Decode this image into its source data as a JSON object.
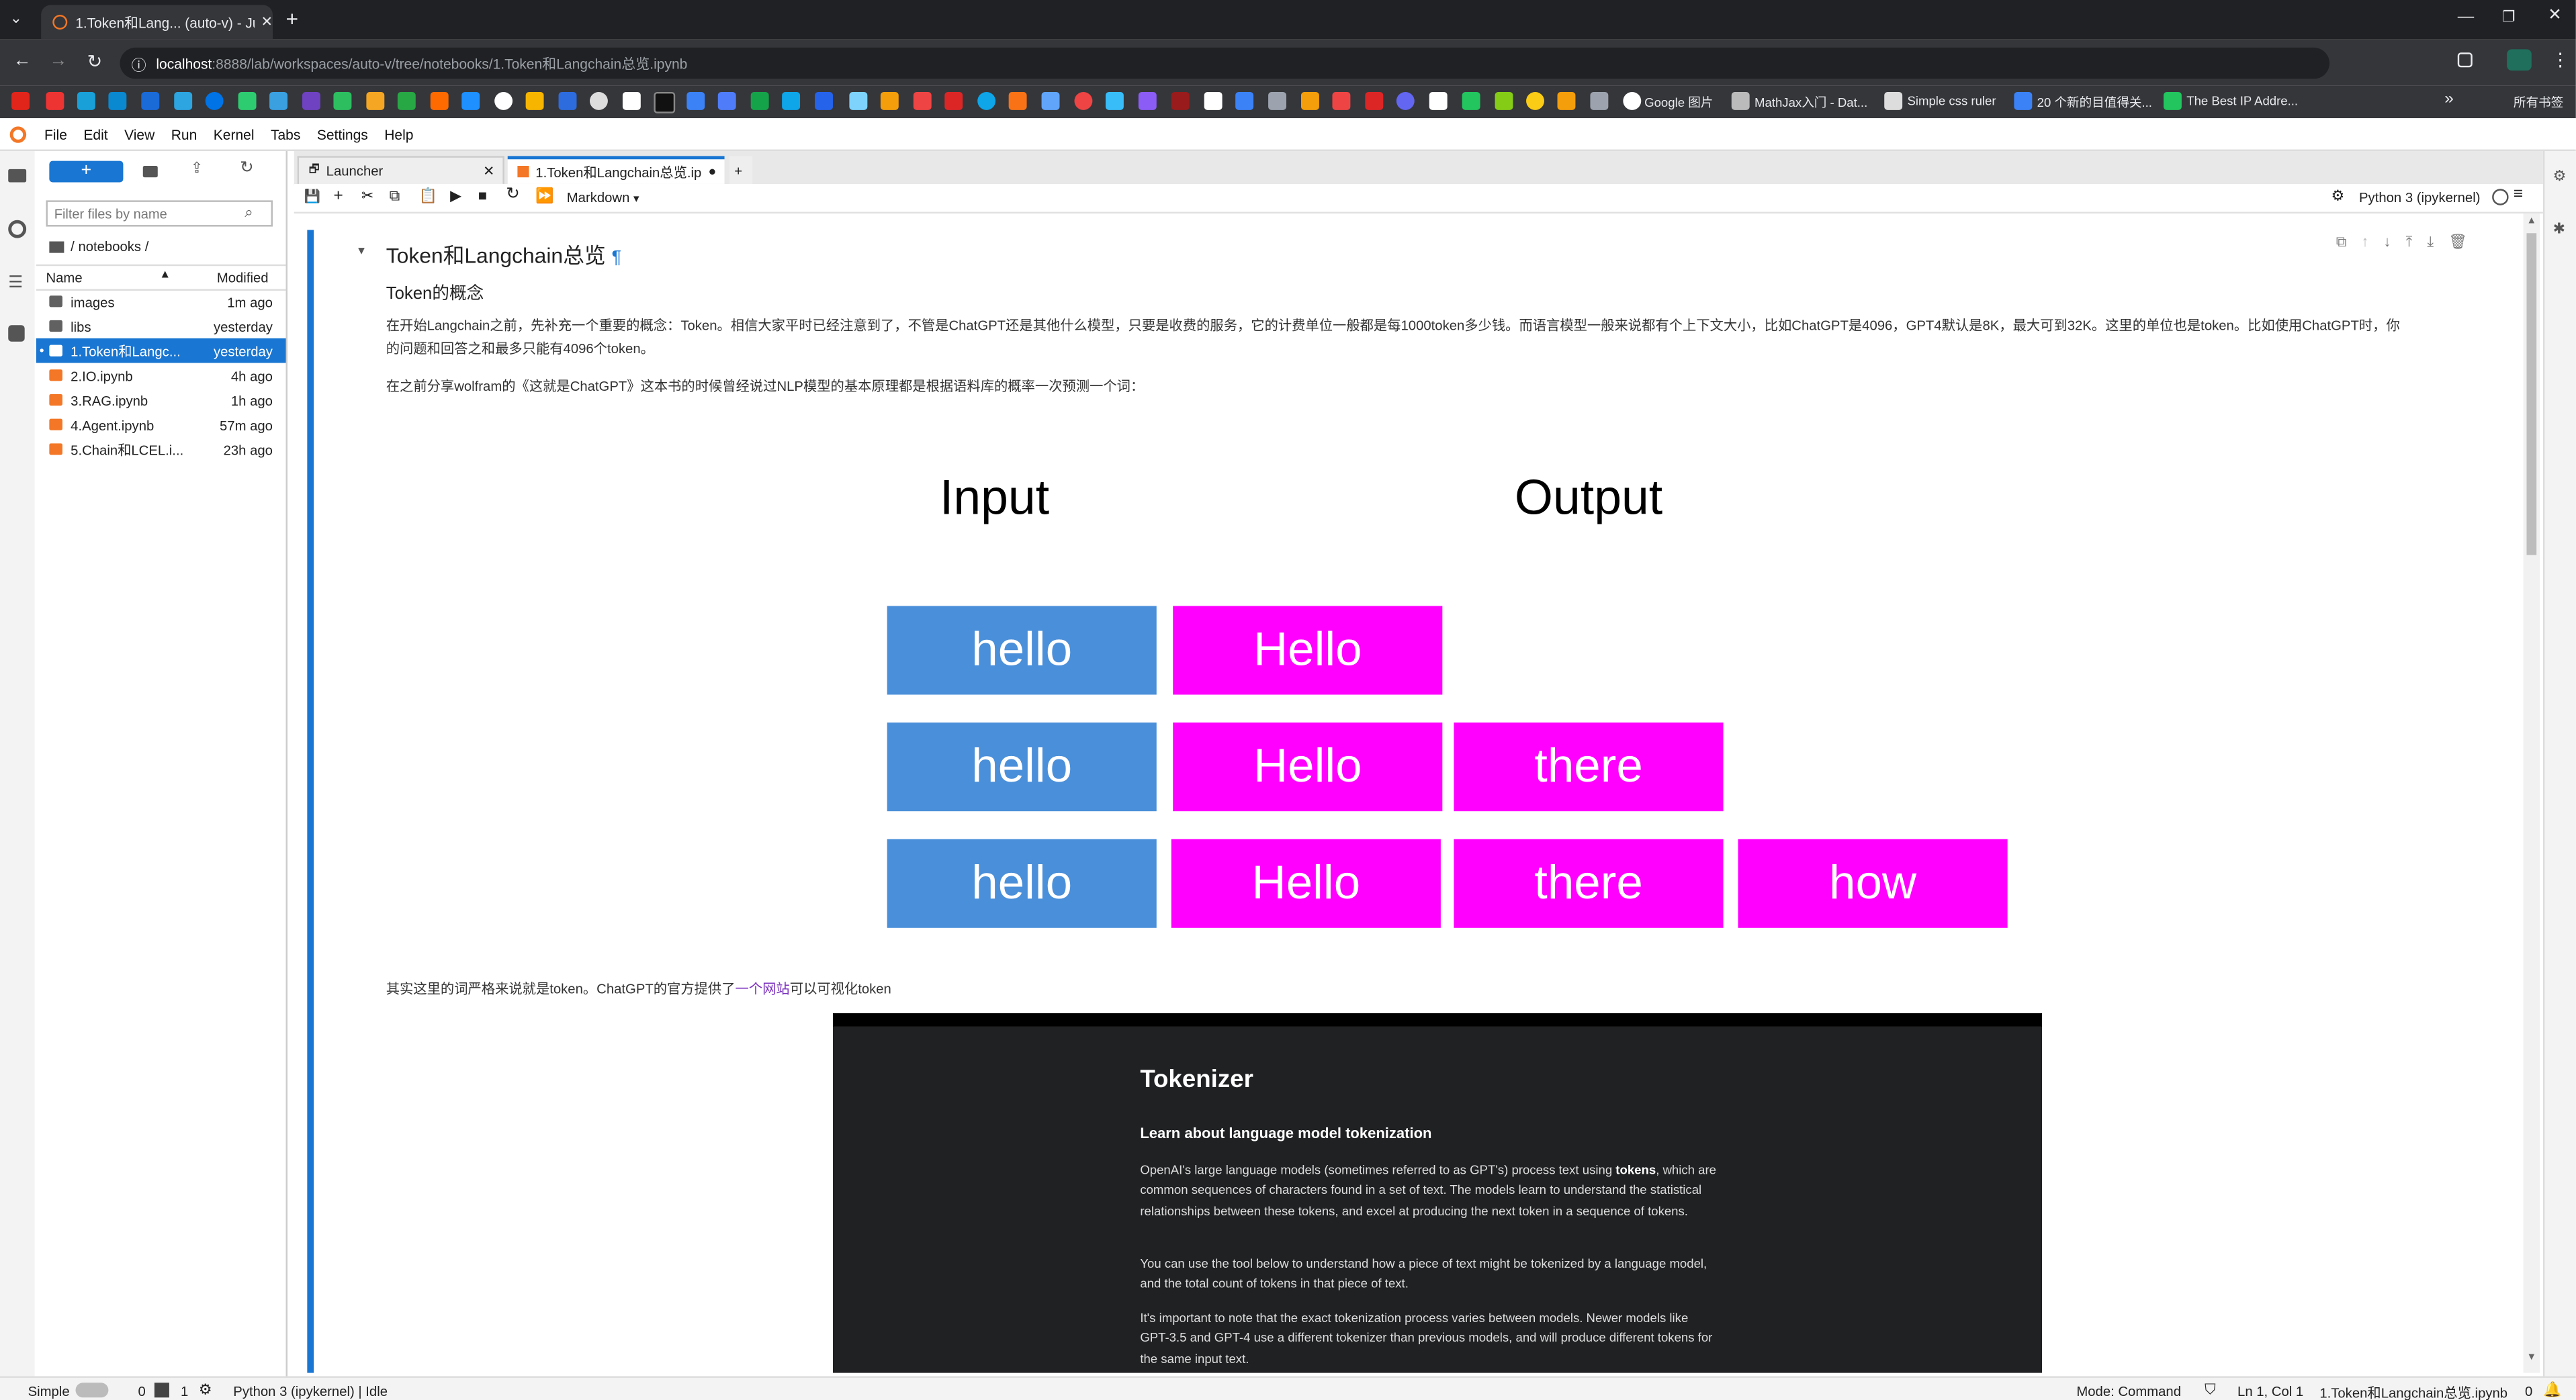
{
  "browser": {
    "tab_title": "1.Token和Lang... (auto-v) - Ju",
    "url_host": "localhost",
    "url_rest": ":8888/lab/workspaces/auto-v/tree/notebooks/1.Token和Langchain总览.ipynb",
    "bookmarks": [
      "Google 图片",
      "MathJax入门 - Dat...",
      "Simple css ruler",
      "20 个新的目值得关...",
      "The Best IP Addre..."
    ],
    "all_bookmarks": "所有书签"
  },
  "menu": [
    "File",
    "Edit",
    "View",
    "Run",
    "Kernel",
    "Tabs",
    "Settings",
    "Help"
  ],
  "filebrowser": {
    "new_label": "+",
    "filter_placeholder": "Filter files by name",
    "path": "/ notebooks /",
    "col_name": "Name",
    "col_modified": "Modified",
    "files": [
      {
        "name": "images",
        "modified": "1m ago",
        "type": "folder"
      },
      {
        "name": "libs",
        "modified": "yesterday",
        "type": "folder"
      },
      {
        "name": "1.Token和Langc...",
        "modified": "yesterday",
        "type": "notebook",
        "selected": true
      },
      {
        "name": "2.IO.ipynb",
        "modified": "4h ago",
        "type": "notebook"
      },
      {
        "name": "3.RAG.ipynb",
        "modified": "1h ago",
        "type": "notebook"
      },
      {
        "name": "4.Agent.ipynb",
        "modified": "57m ago",
        "type": "notebook"
      },
      {
        "name": "5.Chain和LCEL.i...",
        "modified": "23h ago",
        "type": "notebook"
      }
    ]
  },
  "tabs": {
    "launcher": "Launcher",
    "notebook": "1.Token和Langchain总览.ip"
  },
  "toolbar": {
    "cell_type": "Markdown",
    "kernel": "Python 3 (ipykernel)"
  },
  "notebook": {
    "heading": "Token和Langchain总览",
    "pilcrow": "¶",
    "subheading": "Token的概念",
    "para1": "在开始Langchain之前，先补充一个重要的概念：Token。相信大家平时已经注意到了，不管是ChatGPT还是其他什么模型，只要是收费的服务，它的计费单位一般都是每1000token多少钱。而语言模型一般来说都有个上下文大小，比如ChatGPT是4096，GPT4默认是8K，最大可到32K。这里的单位也是token。比如使用ChatGPT时，你",
    "para1b": "的问题和回答之和最多只能有4096个token。",
    "para2": "在之前分享wolfram的《这就是ChatGPT》这本书的时候曾经说过NLP模型的基本原理都是根据语料库的概率一次预测一个词：",
    "para3_pre": "其实这里的词严格来说就是token。ChatGPT的官方提供了",
    "para3_link": "一个网站",
    "para3_post": "可以可视化token"
  },
  "diagram": {
    "input_label": "Input",
    "output_label": "Output",
    "input_color": "#4a8fd9",
    "output_color": "#ff00ff",
    "rows": [
      {
        "input": "hello",
        "outputs": [
          "Hello"
        ]
      },
      {
        "input": "hello",
        "outputs": [
          "Hello",
          "there"
        ]
      },
      {
        "input": "hello",
        "outputs": [
          "Hello",
          "there",
          "how"
        ]
      }
    ]
  },
  "tokenizer": {
    "title": "Tokenizer",
    "subtitle": "Learn about language model tokenization",
    "p1_a": "OpenAI's large language models (sometimes referred to as GPT's) process text using ",
    "p1_b": "tokens",
    "p1_c": ", which are common sequences of characters found in a set of text. The models learn to understand the statistical relationships between these tokens, and excel at producing the next token in a sequence of tokens.",
    "p2": "You can use the tool below to understand how a piece of text might be tokenized by a language model, and the total count of tokens in that piece of text.",
    "p3": "It's important to note that the exact tokenization process varies between models. Newer models like GPT-3.5 and GPT-4 use a different tokenizer than previous models, and will produce different tokens for the same input text."
  },
  "status": {
    "mode_label": "Simple",
    "zero": "0",
    "one": "1",
    "kernel_status": "Python 3 (ipykernel) | Idle",
    "command_mode": "Mode: Command",
    "cursor": "Ln 1, Col 1",
    "filename": "1.Token和Langchain总览.ipynb",
    "notifications": "0"
  }
}
